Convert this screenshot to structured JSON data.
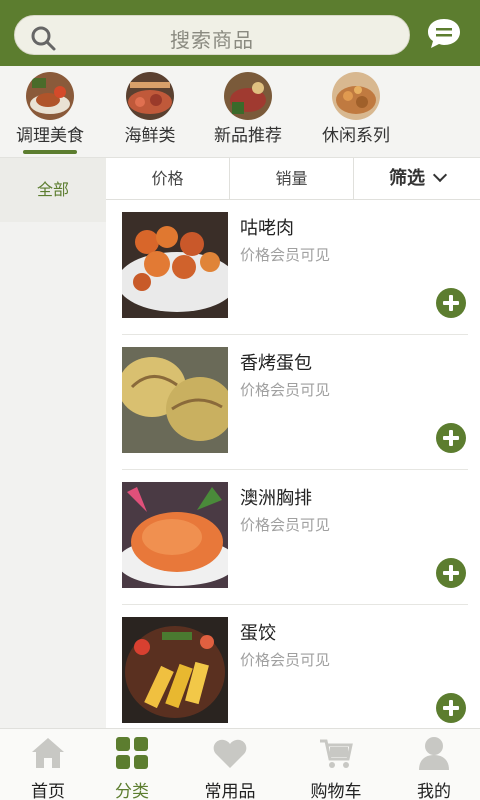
{
  "header": {
    "search_placeholder": "搜索商品",
    "search_icon": "search-icon",
    "message_icon": "chat-icon",
    "brand_color": "#5c7d2f"
  },
  "categories": [
    {
      "label": "调理美食",
      "active": true
    },
    {
      "label": "海鲜类",
      "active": false
    },
    {
      "label": "新品推荐",
      "active": false
    },
    {
      "label": "休闲系列",
      "active": false
    }
  ],
  "sidebar": {
    "items": [
      {
        "label": "全部",
        "selected": true
      }
    ]
  },
  "sort_bar": {
    "price_label": "价格",
    "sales_label": "销量",
    "filter_label": "筛选"
  },
  "products": [
    {
      "name": "咕咾肉",
      "price_text": "价格会员可见"
    },
    {
      "name": "香烤蛋包",
      "price_text": "价格会员可见"
    },
    {
      "name": "澳洲胸排",
      "price_text": "价格会员可见"
    },
    {
      "name": "蛋饺",
      "price_text": "价格会员可见"
    }
  ],
  "tabbar": {
    "tabs": [
      {
        "label": "首页",
        "icon": "home-icon",
        "active": false
      },
      {
        "label": "分类",
        "icon": "category-grid-icon",
        "active": true
      },
      {
        "label": "常用品",
        "icon": "heart-icon",
        "active": false
      },
      {
        "label": "购物车",
        "icon": "cart-icon",
        "active": false
      },
      {
        "label": "我的",
        "icon": "user-icon",
        "active": false
      }
    ]
  }
}
